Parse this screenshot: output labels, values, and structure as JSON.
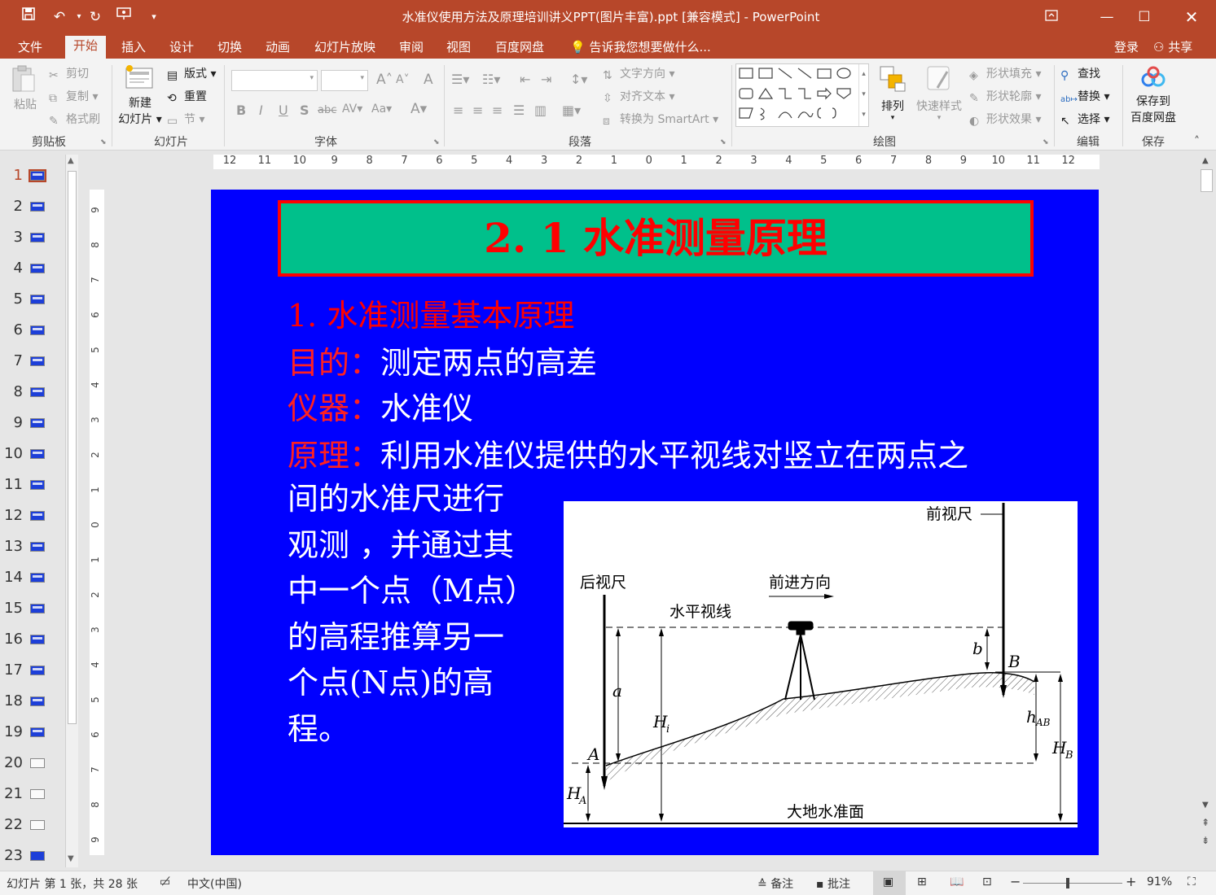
{
  "titlebar": {
    "title": "水准仪使用方法及原理培训讲义PPT(图片丰富).ppt [兼容模式] - PowerPoint",
    "qa_more": "▾"
  },
  "menu": {
    "file": "文件",
    "tabs": [
      "开始",
      "插入",
      "设计",
      "切换",
      "动画",
      "幻灯片放映",
      "审阅",
      "视图",
      "百度网盘"
    ],
    "tellme": "告诉我您想要做什么...",
    "login": "登录",
    "share": "共享"
  },
  "ribbon": {
    "clipboard": {
      "paste": "粘贴",
      "cut": "剪切",
      "copy": "复制",
      "format_painter": "格式刷",
      "label": "剪贴板"
    },
    "slides": {
      "new_slide_1": "新建",
      "new_slide_2": "幻灯片",
      "layout": "版式",
      "reset": "重置",
      "section": "节",
      "label": "幻灯片"
    },
    "font": {
      "bold": "B",
      "italic": "I",
      "underline": "U",
      "shadow": "S",
      "strike": "abc",
      "spacing": "AV",
      "case": "Aa",
      "color": "A",
      "grow": "A",
      "shrink": "A",
      "clear": "A",
      "label": "字体"
    },
    "paragraph": {
      "text_direction": "文字方向",
      "align_text": "对齐文本",
      "smartart": "转换为 SmartArt",
      "label": "段落"
    },
    "drawing": {
      "arrange": "排列",
      "quick_styles": "快速样式",
      "shape_fill": "形状填充",
      "shape_outline": "形状轮廓",
      "shape_effects": "形状效果",
      "label": "绘图"
    },
    "editing": {
      "find": "查找",
      "replace": "替换",
      "select": "选择",
      "label": "编辑"
    },
    "save": {
      "save_1": "保存到",
      "save_2": "百度网盘",
      "label": "保存"
    }
  },
  "thumbnails": [
    "1",
    "2",
    "3",
    "4",
    "5",
    "6",
    "7",
    "8",
    "9",
    "10",
    "11",
    "12",
    "13",
    "14",
    "15",
    "16",
    "17",
    "18",
    "19",
    "20",
    "21",
    "22",
    "23"
  ],
  "ruler": {
    "h_ticks": [
      "12",
      "11",
      "10",
      "9",
      "8",
      "7",
      "6",
      "5",
      "4",
      "3",
      "2",
      "1",
      "0",
      "1",
      "2",
      "3",
      "4",
      "5",
      "6",
      "7",
      "8",
      "9",
      "10",
      "11",
      "12"
    ],
    "v_ticks": [
      "9",
      "8",
      "7",
      "6",
      "5",
      "4",
      "3",
      "2",
      "1",
      "0",
      "1",
      "2",
      "3",
      "4",
      "5",
      "6",
      "7",
      "8",
      "9"
    ]
  },
  "slide": {
    "title": "2. 1 水准测量原理",
    "heading": "1. 水准测量基本原理",
    "purpose_label": "目的：",
    "purpose_text": "测定两点的高差",
    "instrument_label": "仪器：",
    "instrument_text": "水准仪",
    "principle_label": "原理：",
    "principle_line1": "利用水准仪提供的水平视线对竖立在两点之",
    "principle_lines": [
      "间的水准尺进行",
      "观测 ，并通过其",
      "中一个点（M点）",
      "的高程推算另一",
      "个点(N点)的高",
      "程。"
    ],
    "figure": {
      "front_rod": "前视尺",
      "back_rod": "后视尺",
      "direction": "前进方向",
      "sight_line": "水平视线",
      "a": "a",
      "b": "b",
      "Hi": "H",
      "Hi_sub": "i",
      "A": "A",
      "B": "B",
      "hAB": "h",
      "hAB_sub": "AB",
      "HB": "H",
      "HB_sub": "B",
      "HA": "H",
      "HA_sub": "A",
      "datum": "大地水准面"
    }
  },
  "status": {
    "slide_info": "幻灯片 第 1 张，共 28 张",
    "language": "中文(中国)",
    "notes": "备注",
    "comments": "批注",
    "zoom": "91%"
  },
  "colors": {
    "brand": "#b7472a",
    "slide_bg": "#0000ff",
    "title_box": "#00c08b",
    "red_text": "#ff2020"
  }
}
